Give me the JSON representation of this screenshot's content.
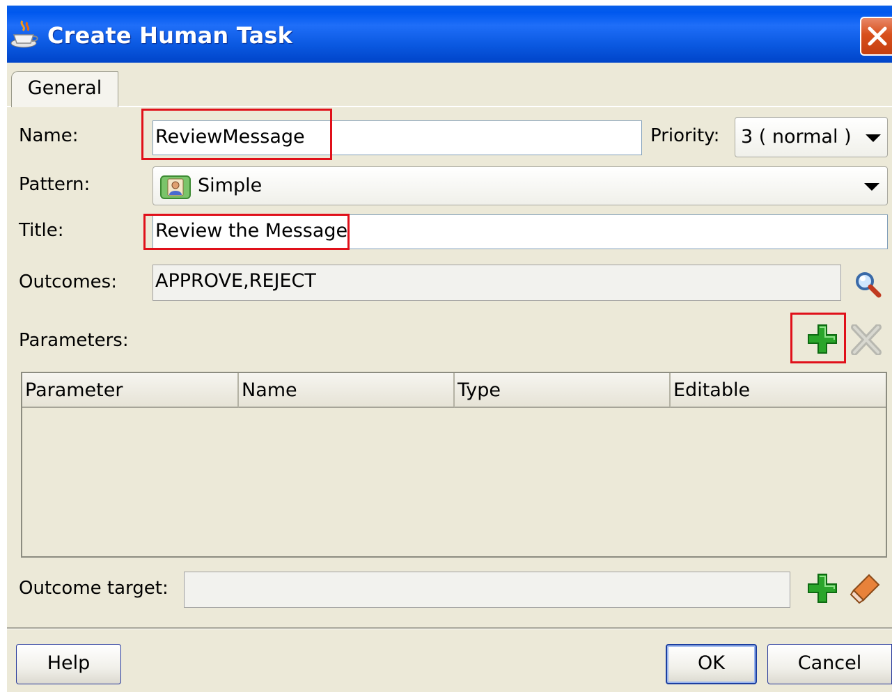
{
  "window": {
    "title": "Create Human Task",
    "icon": "java-cup-icon",
    "close_icon": "close-icon"
  },
  "tabs": [
    {
      "label": "General",
      "selected": true
    }
  ],
  "form": {
    "name_label": "Name:",
    "name_value": "ReviewMessage",
    "priority_label": "Priority:",
    "priority_value": "3 ( normal )",
    "pattern_label": "Pattern:",
    "pattern_value": "Simple",
    "pattern_icon": "person-icon",
    "title_label": "Title:",
    "title_value": "Review the Message",
    "outcomes_label": "Outcomes:",
    "outcomes_value": "APPROVE,REJECT",
    "outcomes_icon": "search-icon",
    "parameters_label": "Parameters:",
    "outcome_target_label": "Outcome target:",
    "outcome_target_value": ""
  },
  "parameters_table": {
    "columns": [
      "Parameter",
      "Name",
      "Type",
      "Editable"
    ],
    "rows": []
  },
  "buttons": {
    "help": "Help",
    "ok": "OK",
    "cancel": "Cancel"
  },
  "colors": {
    "titlebar": "#0058ee",
    "highlight": "#e0101a",
    "add_green": "#2aa52a",
    "dialog_bg": "#ece9d8"
  }
}
